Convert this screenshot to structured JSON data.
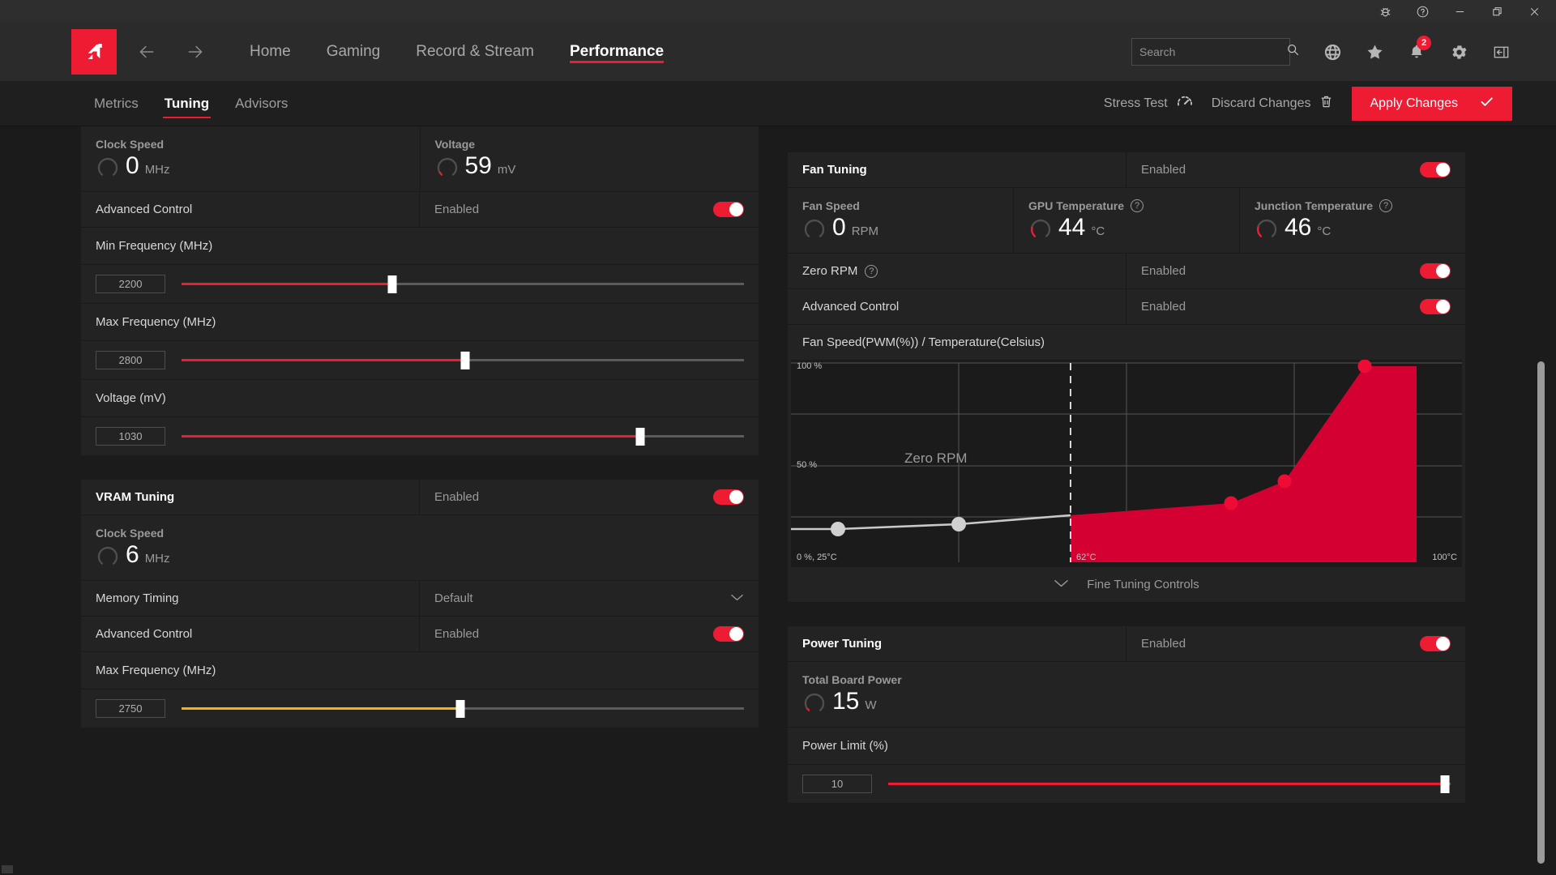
{
  "titlebar": {
    "buttons": [
      {
        "name": "bug-report-icon",
        "label": "Bug Report"
      },
      {
        "name": "help-icon",
        "label": "Help"
      },
      {
        "name": "minimize-icon",
        "label": "Minimize"
      },
      {
        "name": "restore-icon",
        "label": "Restore"
      },
      {
        "name": "close-icon",
        "label": "Close"
      }
    ]
  },
  "header": {
    "logo_alt": "AMD",
    "back_label": "Back",
    "forward_label": "Forward",
    "nav": [
      {
        "label": "Home",
        "active": false
      },
      {
        "label": "Gaming",
        "active": false
      },
      {
        "label": "Record & Stream",
        "active": false
      },
      {
        "label": "Performance",
        "active": true
      }
    ],
    "search": {
      "value": "",
      "placeholder": "Search"
    },
    "icons": [
      {
        "name": "globe-icon",
        "label": "Language"
      },
      {
        "name": "star-icon",
        "label": "Favorites"
      },
      {
        "name": "bell-icon",
        "label": "Notifications",
        "badge": "2"
      },
      {
        "name": "gear-icon",
        "label": "Settings"
      },
      {
        "name": "collapse-panel-icon",
        "label": "Collapse Panel"
      }
    ]
  },
  "subnav": {
    "tabs": [
      {
        "label": "Metrics",
        "active": false
      },
      {
        "label": "Tuning",
        "active": true
      },
      {
        "label": "Advisors",
        "active": false
      }
    ],
    "stress_test": "Stress Test",
    "discard_changes": "Discard Changes",
    "apply_changes": "Apply Changes"
  },
  "gpu_tuning": {
    "clock_speed": {
      "label": "Clock Speed",
      "value": "0",
      "unit": "MHz"
    },
    "voltage": {
      "label": "Voltage",
      "value": "59",
      "unit": "mV"
    },
    "advanced_control": {
      "label": "Advanced Control",
      "state": "Enabled"
    },
    "min_frequency": {
      "label": "Min Frequency (MHz)",
      "value": "2200",
      "percent": 37.5
    },
    "max_frequency": {
      "label": "Max Frequency (MHz)",
      "value": "2800",
      "percent": 50.5
    },
    "voltage_slider": {
      "label": "Voltage (mV)",
      "value": "1030",
      "percent": 81.5
    }
  },
  "vram_tuning": {
    "title": "VRAM Tuning",
    "state": "Enabled",
    "clock_speed": {
      "label": "Clock Speed",
      "value": "6",
      "unit": "MHz"
    },
    "memory_timing": {
      "label": "Memory Timing",
      "value": "Default"
    },
    "advanced_control": {
      "label": "Advanced Control",
      "state": "Enabled"
    },
    "max_frequency": {
      "label": "Max Frequency (MHz)",
      "value": "2750",
      "percent": 49.5
    }
  },
  "fan_tuning": {
    "title": "Fan Tuning",
    "state": "Enabled",
    "fan_speed": {
      "label": "Fan Speed",
      "value": "0",
      "unit": "RPM"
    },
    "gpu_temperature": {
      "label": "GPU Temperature",
      "value": "44",
      "unit": "°C"
    },
    "junction_temperature": {
      "label": "Junction Temperature",
      "value": "46",
      "unit": "°C"
    },
    "zero_rpm": {
      "label": "Zero RPM",
      "state": "Enabled"
    },
    "advanced_control": {
      "label": "Advanced Control",
      "state": "Enabled"
    },
    "fine_tuning_controls": "Fine Tuning Controls"
  },
  "power_tuning": {
    "title": "Power Tuning",
    "state": "Enabled",
    "total_board_power": {
      "label": "Total Board Power",
      "value": "15",
      "unit": "W"
    },
    "power_limit": {
      "label": "Power Limit (%)",
      "value": "10",
      "percent": 99.0
    }
  },
  "colors": {
    "accent_red": "#ed1c33",
    "curve_red": "#d50032",
    "vram_yellow": "#f2b705",
    "zero_rpm_grey": "#c9c9c9"
  },
  "chart_data": {
    "type": "line",
    "title": "Fan Speed(PWM(%)) / Temperature(Celsius)",
    "xlabel": "Temperature(Celsius)",
    "ylabel": "Fan Speed(PWM(%))",
    "xlim": [
      25,
      100
    ],
    "ylim": [
      0,
      100
    ],
    "grid": true,
    "legend": "none",
    "y_tick_labels": [
      "100 %",
      "50 %"
    ],
    "y_ticks": [
      100,
      50
    ],
    "x_tick_labels": [
      "0 %, 25°C",
      "62°C",
      "100°C"
    ],
    "origin_label": "0 %, 25°C",
    "zero_rpm_label": "Zero RPM",
    "zero_rpm_threshold_c": 62,
    "annotations": [
      {
        "text": "Zero RPM",
        "x": 45,
        "y": 50
      },
      {
        "text": "62°C",
        "x": 62,
        "y": 0
      },
      {
        "text": "100°C",
        "x": 100,
        "y": 0
      }
    ],
    "series": [
      {
        "name": "Zero RPM segment",
        "color": "#c9c9c9",
        "points": [
          {
            "x": 25,
            "y": 18,
            "handle": false
          },
          {
            "x": 31,
            "y": 18,
            "handle": true
          },
          {
            "x": 50,
            "y": 21,
            "handle": true
          },
          {
            "x": 62,
            "y": 23,
            "handle": false
          }
        ]
      },
      {
        "name": "Fan curve",
        "color": "#d50032",
        "fill": true,
        "points": [
          {
            "x": 62,
            "y": 23,
            "handle": false
          },
          {
            "x": 80,
            "y": 29,
            "handle": true
          },
          {
            "x": 86,
            "y": 40,
            "handle": true
          },
          {
            "x": 95,
            "y": 100,
            "handle": true
          },
          {
            "x": 100,
            "y": 100,
            "handle": false
          }
        ]
      }
    ]
  }
}
